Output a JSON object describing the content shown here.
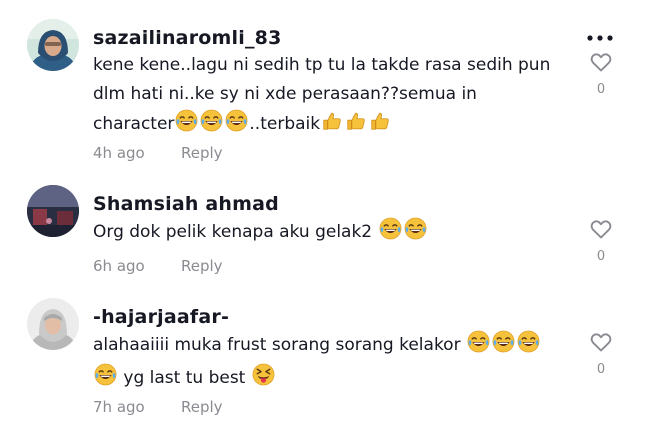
{
  "comments": [
    {
      "username": "sazailinaromli_83",
      "text_lines": [
        "kene kene..lagu ni sedih tp tu la takde rasa sedih pun",
        "dlm hati ni..ke sy ni xde perasaan??semua in",
        "character",
        "..terbaik"
      ],
      "time": "4h ago",
      "reply_label": "Reply",
      "likes": "0"
    },
    {
      "username": "Shamsiah ahmad",
      "text": "Org dok pelik kenapa aku gelak2",
      "time": "6h ago",
      "reply_label": "Reply",
      "likes": "0"
    },
    {
      "username": "-hajarjaafar-",
      "text_lines": [
        "alahaaiiii muka frust sorang sorang kelakor",
        "yg last tu best"
      ],
      "time": "7h ago",
      "reply_label": "Reply",
      "likes": "0"
    }
  ],
  "icons": {
    "laugh": "face-with-tears-of-joy-icon",
    "thumbs": "thumbs-up-icon",
    "tongue": "squinting-face-with-tongue-icon",
    "heart": "heart-outline-icon",
    "more": "more-options-icon"
  },
  "colors": {
    "text": "#161823",
    "muted": "#8a8b91",
    "emoji_yellow": "#f7c23b"
  }
}
